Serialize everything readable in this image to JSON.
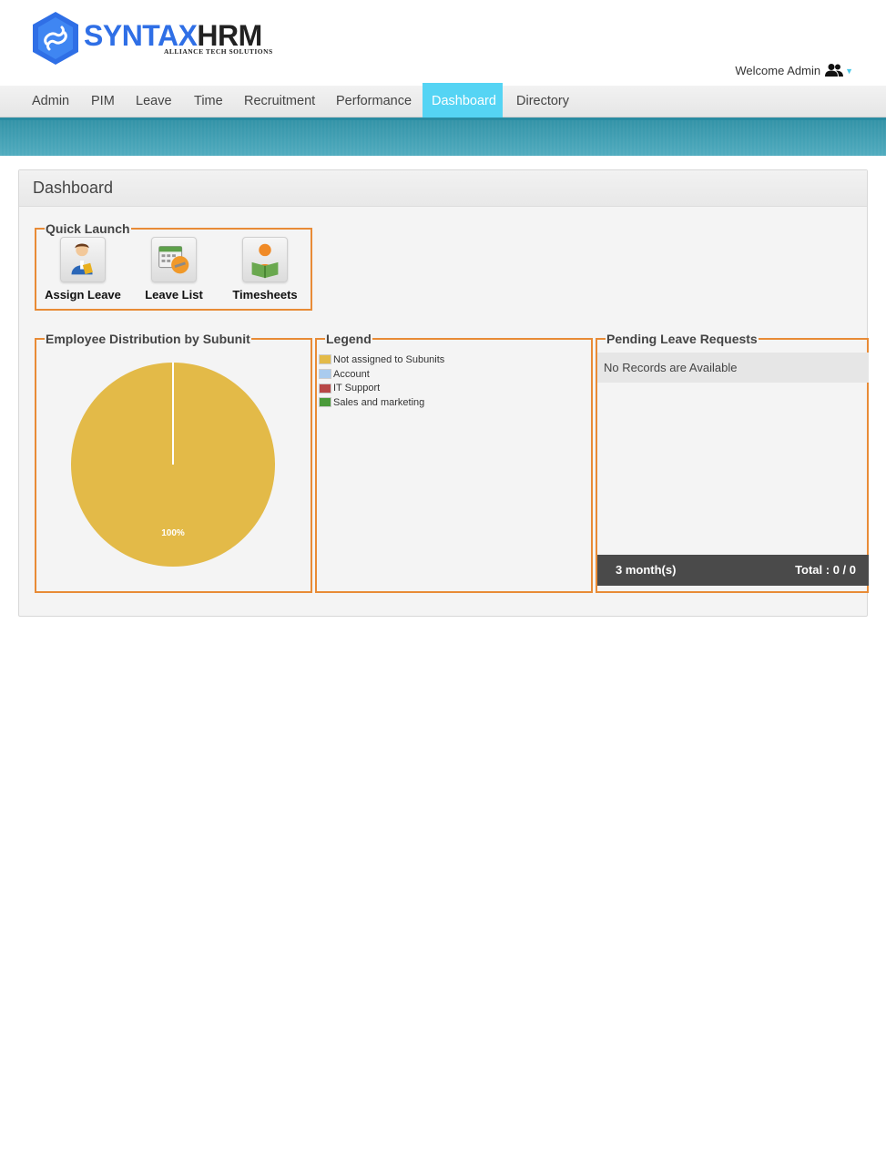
{
  "header": {
    "logo": {
      "brand_part1": "SYNTAX",
      "brand_part2": "HRM",
      "tagline": "ALLIANCE TECH SOLUTIONS"
    },
    "welcome_text": "Welcome Admin",
    "user_icon": "users-icon",
    "caret_icon": "caret-down-icon"
  },
  "nav": {
    "items": [
      {
        "label": "Admin"
      },
      {
        "label": "PIM"
      },
      {
        "label": "Leave"
      },
      {
        "label": "Time"
      },
      {
        "label": "Recruitment"
      },
      {
        "label": "Performance"
      },
      {
        "label": "Dashboard",
        "active": true
      },
      {
        "label": "Directory"
      }
    ],
    "active_color": "#55d4f4"
  },
  "panel": {
    "title": "Dashboard",
    "quick_launch": {
      "legend": "Quick Launch",
      "items": [
        {
          "label": "Assign Leave",
          "icon": "assign-leave-icon"
        },
        {
          "label": "Leave List",
          "icon": "leave-list-icon"
        },
        {
          "label": "Timesheets",
          "icon": "timesheets-icon"
        }
      ]
    },
    "distribution": {
      "legend": "Employee Distribution by Subunit"
    },
    "legend": {
      "title": "Legend",
      "entries": [
        {
          "label": "Not assigned to Subunits",
          "color": "#e3ba48"
        },
        {
          "label": "Account",
          "color": "#a9cbee"
        },
        {
          "label": "IT Support",
          "color": "#b84747"
        },
        {
          "label": "Sales and marketing",
          "color": "#4a9a3a"
        }
      ]
    },
    "pending": {
      "legend": "Pending Leave Requests",
      "empty_text": "No Records are Available",
      "period": "3 month(s)",
      "total": "Total : 0 / 0"
    }
  },
  "chart_data": {
    "type": "pie",
    "categories": [
      "Not assigned to Subunits",
      "Account",
      "IT Support",
      "Sales and marketing"
    ],
    "values": [
      100,
      0,
      0,
      0
    ],
    "colors": [
      "#e3ba48",
      "#a9cbee",
      "#b84747",
      "#4a9a3a"
    ],
    "data_labels": [
      "100%"
    ],
    "title": "Employee Distribution by Subunit"
  }
}
